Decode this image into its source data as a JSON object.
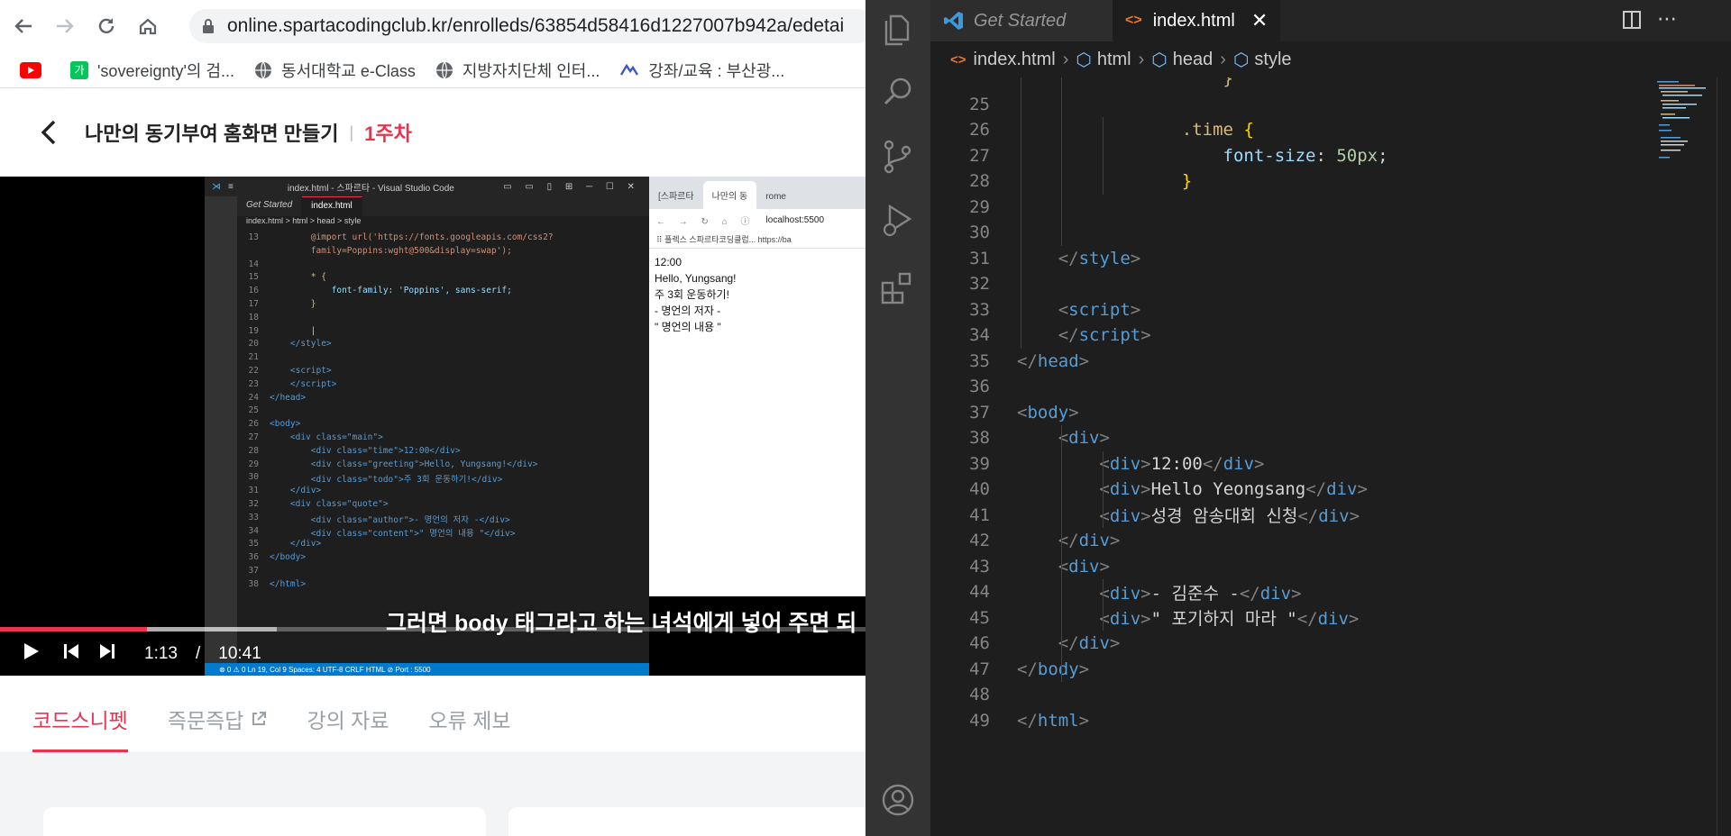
{
  "browser": {
    "url": "online.spartacodingclub.kr/enrolleds/63854d58416d1227007b942a/edetai",
    "bookmarks": [
      {
        "label": "",
        "icon": "youtube-icon"
      },
      {
        "label": "'sovereignty'의 검...",
        "icon": "naver-dict-icon"
      },
      {
        "label": "동서대학교 e-Class",
        "icon": "globe-icon"
      },
      {
        "label": "지방자치단체 인터...",
        "icon": "globe-icon"
      },
      {
        "label": "강좌/교육 : 부산광...",
        "icon": "bookmark-icon"
      }
    ]
  },
  "course": {
    "title": "나만의 동기부여 홈화면 만들기",
    "week": "1주차"
  },
  "video": {
    "subtitle": "그러면 body 태그라고 하는 녀석에게 넣어 주면 되",
    "current_time": "1:13",
    "time_sep": "/",
    "duration": "10:41",
    "progress": 0.17,
    "buffered": 0.32,
    "inner_vscode": {
      "title": "index.html - 스파르타 - Visual Studio Code",
      "tabs": [
        "Get Started",
        "index.html"
      ],
      "breadcrumb": "index.html  > html > head > style",
      "status": "⊗ 0 ⚠ 0          Ln 19, Col 9   Spaces: 4   UTF-8   CRLF   HTML   ⊘ Port : 5500"
    },
    "inner_browser": {
      "tabs": [
        "[스파르타",
        "나만의 동",
        "rome"
      ],
      "url": "localhost:5500",
      "bookmarks": "⠿ 플렉스   스파르타코딩클럽...   https://ba",
      "lines": [
        "12:00",
        "Hello, Yungsang!",
        "주 3회 운동하기!",
        "- 명언의 저자 -",
        "\" 명언의 내용 \""
      ]
    }
  },
  "content_tabs": [
    {
      "label": "코드스니펫",
      "active": true
    },
    {
      "label": "즉문즉답",
      "active": false,
      "external": true
    },
    {
      "label": "강의 자료",
      "active": false
    },
    {
      "label": "오류 제보",
      "active": false
    }
  ],
  "vscode": {
    "tabs": [
      {
        "label": "Get Started",
        "active": false
      },
      {
        "label": "index.html",
        "active": true
      }
    ],
    "breadcrumbs": [
      "index.html",
      "html",
      "head",
      "style"
    ],
    "accent": "#007acc"
  }
}
